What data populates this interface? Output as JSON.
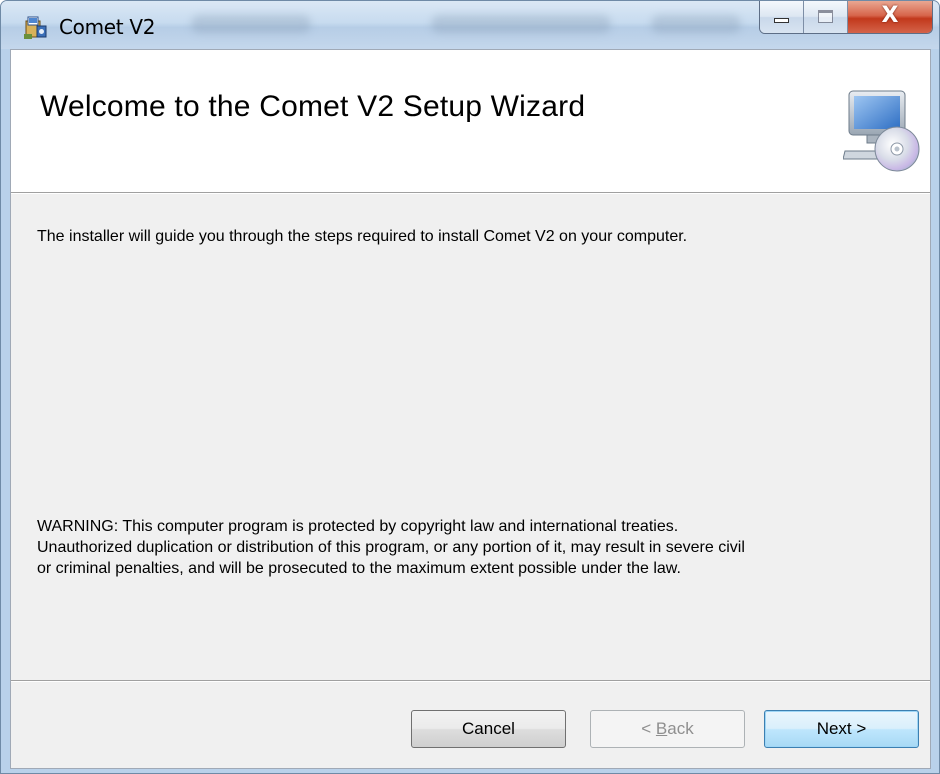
{
  "window": {
    "title": "Comet V2",
    "close_glyph": "X"
  },
  "banner": {
    "title": "Welcome to the Comet V2 Setup Wizard",
    "icon": "computer-cd-icon"
  },
  "body": {
    "intro": "The installer will guide you through the steps required to install Comet V2 on your computer.",
    "warning_lines": [
      "WARNING: This computer program is protected by copyright law and international treaties.",
      "Unauthorized duplication or distribution of this program, or any portion of it, may result in severe civil",
      "or criminal penalties, and will be prosecuted to the maximum extent possible under the law."
    ]
  },
  "buttons": {
    "cancel": "Cancel",
    "back_prefix": "< ",
    "back_accel": "B",
    "back_rest": "ack",
    "next": "Next >"
  },
  "colors": {
    "titlebar": "#c7dbef",
    "client": "#f0f0f0",
    "default_button": "#bee6fd",
    "close_button": "#c2391c"
  }
}
